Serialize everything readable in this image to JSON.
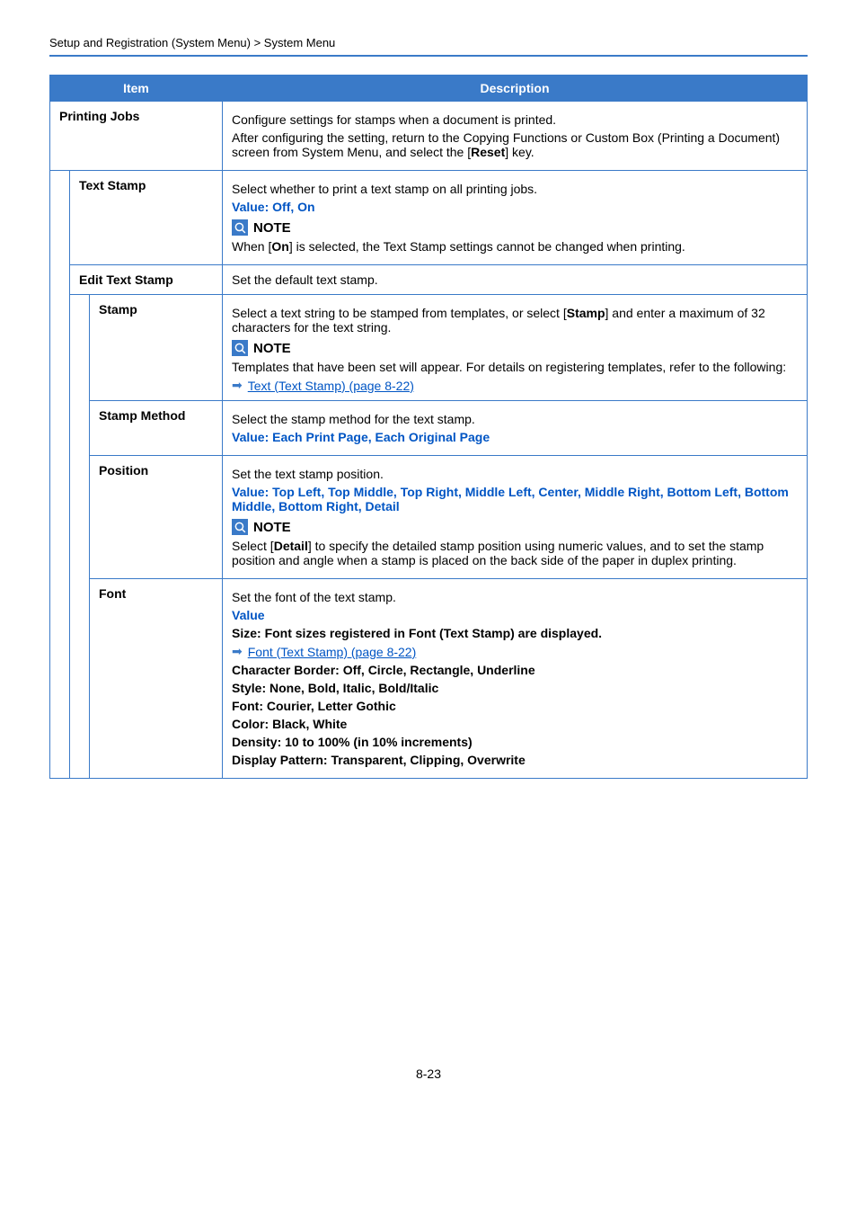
{
  "breadcrumb": "Setup and Registration (System Menu) > System Menu",
  "headers": {
    "item": "Item",
    "description": "Description"
  },
  "rows": {
    "printing_jobs": {
      "label": "Printing Jobs",
      "p1": "Configure settings for stamps when a document is printed.",
      "p2_a": "After configuring the setting, return to the Copying Functions or Custom Box (Printing a Document) screen from System Menu, and select the [",
      "p2_b": "Reset",
      "p2_c": "] key."
    },
    "text_stamp": {
      "label": "Text Stamp",
      "p1": "Select whether to print a text stamp on all printing jobs.",
      "val_label": "Value",
      "val_text": ": Off, On",
      "note": "NOTE",
      "note_a": "When [",
      "note_b": "On",
      "note_c": "] is selected, the Text Stamp settings cannot be changed when printing."
    },
    "edit_text_stamp": {
      "label": "Edit Text Stamp",
      "p1": "Set the default text stamp."
    },
    "stamp": {
      "label": "Stamp",
      "p1_a": "Select a text string to be stamped from templates, or select [",
      "p1_b": "Stamp",
      "p1_c": "] and enter a maximum of 32 characters for the text string.",
      "note": "NOTE",
      "p2": "Templates that have been set will appear. For details on registering templates, refer to the following:",
      "link": "Text (Text Stamp) (page 8-22)"
    },
    "stamp_method": {
      "label": "Stamp Method",
      "p1": "Select the stamp method for the text stamp.",
      "val_label": "Value",
      "val_text": ": Each Print Page, Each Original Page"
    },
    "position": {
      "label": "Position",
      "p1": "Set the text stamp position.",
      "val_label": "Value",
      "val_text": ": Top Left, Top Middle, Top Right, Middle Left, Center, Middle Right, Bottom Left, Bottom Middle, Bottom Right, Detail",
      "note": "NOTE",
      "p2_a": "Select [",
      "p2_b": "Detail",
      "p2_c": "] to specify the detailed stamp position using numeric values, and to set the stamp position and angle when a stamp is placed on the back side of the paper in duplex printing."
    },
    "font": {
      "label": "Font",
      "p1": "Set the font of the text stamp.",
      "val_label": "Value",
      "size": "Size: Font sizes registered in Font (Text Stamp) are displayed.",
      "link": "Font (Text Stamp) (page 8-22)",
      "char_border": "Character Border: Off, Circle, Rectangle, Underline",
      "style": "Style: None, Bold, Italic, Bold/Italic",
      "font": "Font: Courier, Letter Gothic",
      "color": "Color: Black, White",
      "density": "Density: 10 to 100% (in 10% increments)",
      "pattern": "Display Pattern: Transparent, Clipping, Overwrite"
    }
  },
  "pagenum": "8-23"
}
